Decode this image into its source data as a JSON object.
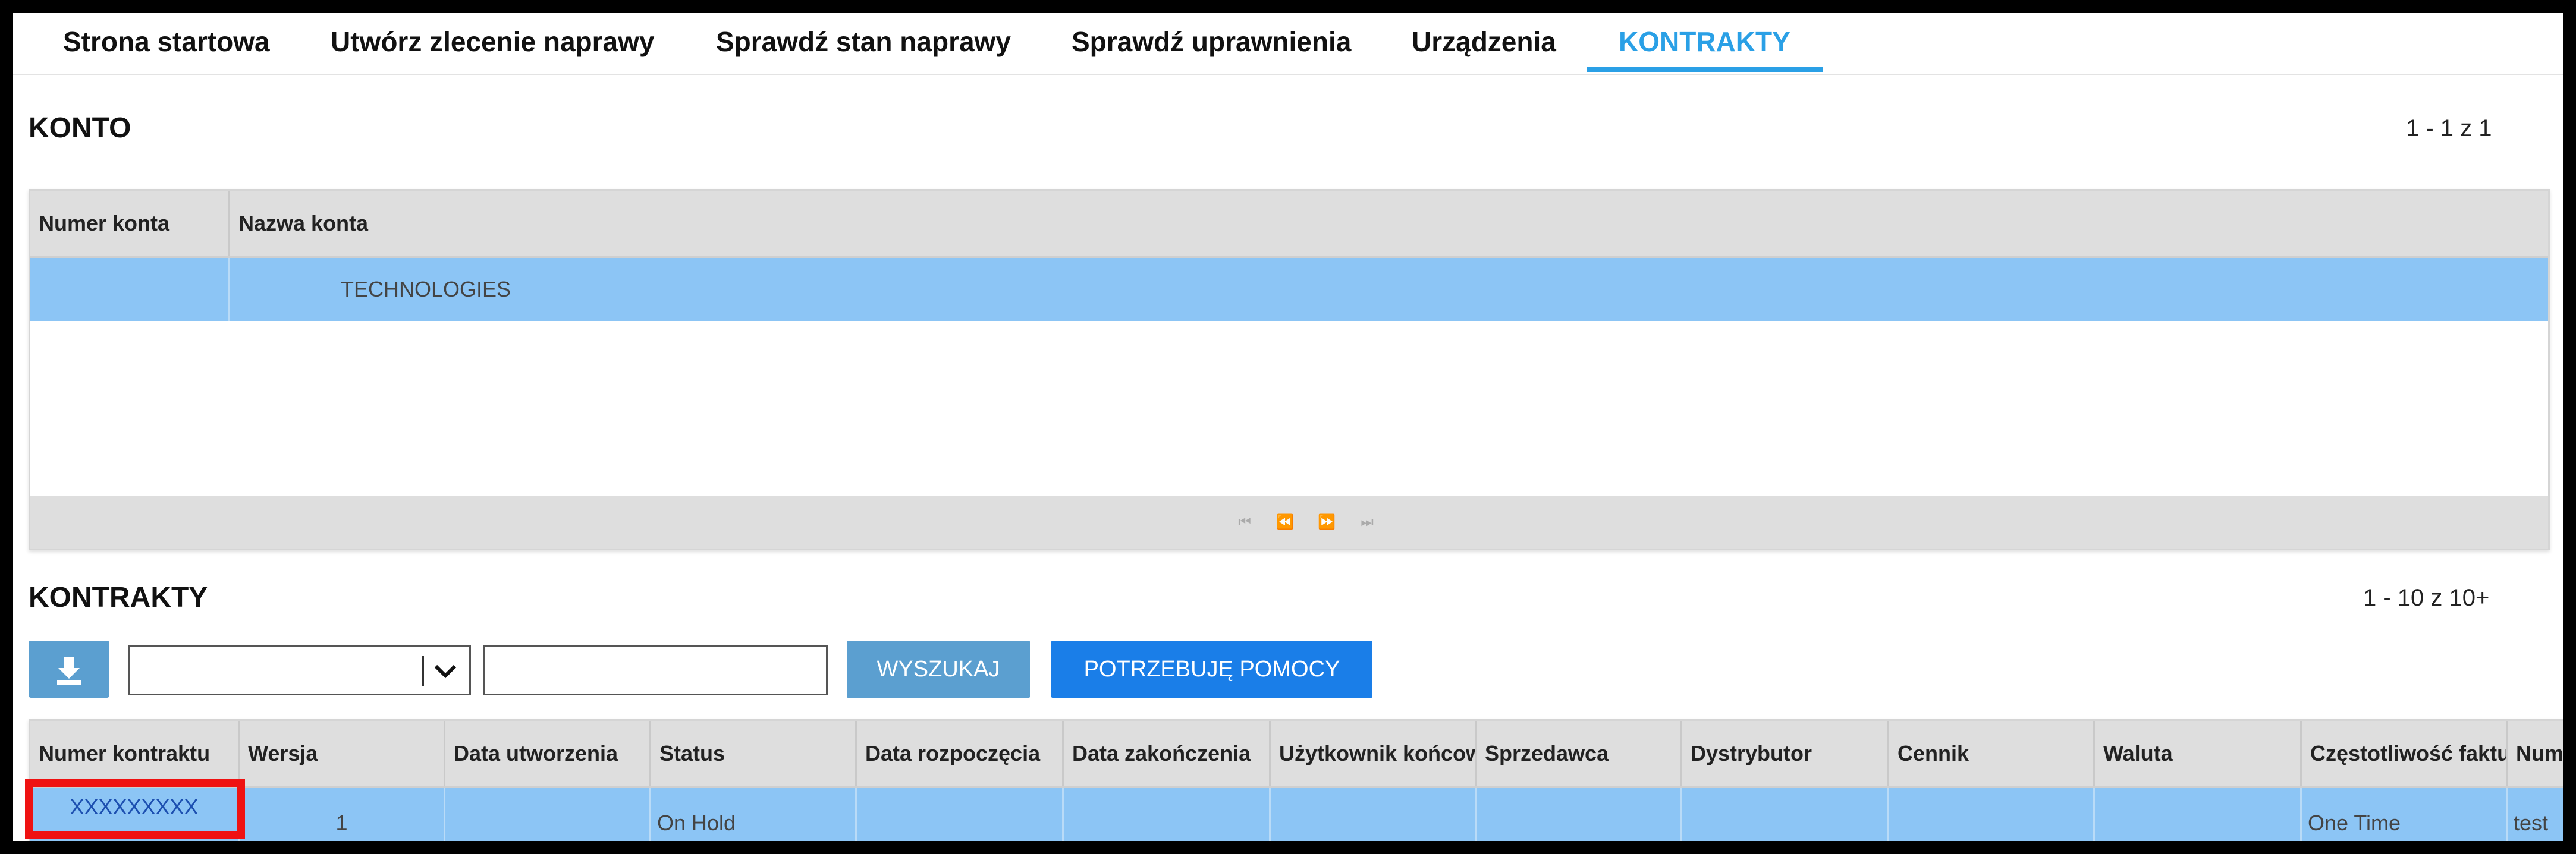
{
  "nav": {
    "tabs": [
      {
        "label": "Strona startowa"
      },
      {
        "label": "Utwórz zlecenie naprawy"
      },
      {
        "label": "Sprawdź stan naprawy"
      },
      {
        "label": "Sprawdź uprawnienia"
      },
      {
        "label": "Urządzenia"
      },
      {
        "label": "KONTRAKTY"
      }
    ],
    "active_index": 5,
    "accent_color": "#2aa0e6"
  },
  "konto": {
    "title": "KONTO",
    "pager": "1 - 1 z 1",
    "columns": [
      "Numer konta",
      "Nazwa konta"
    ],
    "rows": [
      {
        "numer_konta": "",
        "nazwa_konta": "TECHNOLOGIES"
      }
    ],
    "footer_icons": [
      "first-page-icon",
      "prev-page-icon",
      "next-page-icon",
      "last-page-icon"
    ]
  },
  "kontrakty": {
    "title": "KONTRAKTY",
    "pager": "1 - 10 z 10+",
    "toolbar": {
      "download_icon": "download-icon",
      "select_value": "",
      "search_value": "",
      "search_label": "WYSZUKAJ",
      "help_label": "POTRZEBUJĘ POMOCY"
    },
    "columns": [
      "Numer kontraktu",
      "Wersja",
      "Data utworzenia",
      "Status",
      "Data rozpoczęcia",
      "Data zakończenia",
      "Użytkownik końcowy",
      "Sprzedawca",
      "Dystrybutor",
      "Cennik",
      "Waluta",
      "Częstotliwość fakturowania",
      "Numer"
    ],
    "rows": [
      {
        "numer_kontraktu": "XXXXXXXXX",
        "wersja": "1",
        "data_utworzenia": "",
        "status": "On Hold",
        "data_rozpoczecia": "",
        "data_zakonczenia": "",
        "uzytkownik_koncowy": "",
        "sprzedawca": "",
        "dystrybutor": "",
        "cennik": "",
        "waluta": "",
        "czestotliwosc": "One Time",
        "numer": "test"
      }
    ]
  },
  "colors": {
    "selected_row": "#8cc5f5",
    "header_bg": "#dedede",
    "button_blue": "#5b9fd0",
    "button_primary": "#1a7ee8",
    "highlight": "#ef1212"
  }
}
